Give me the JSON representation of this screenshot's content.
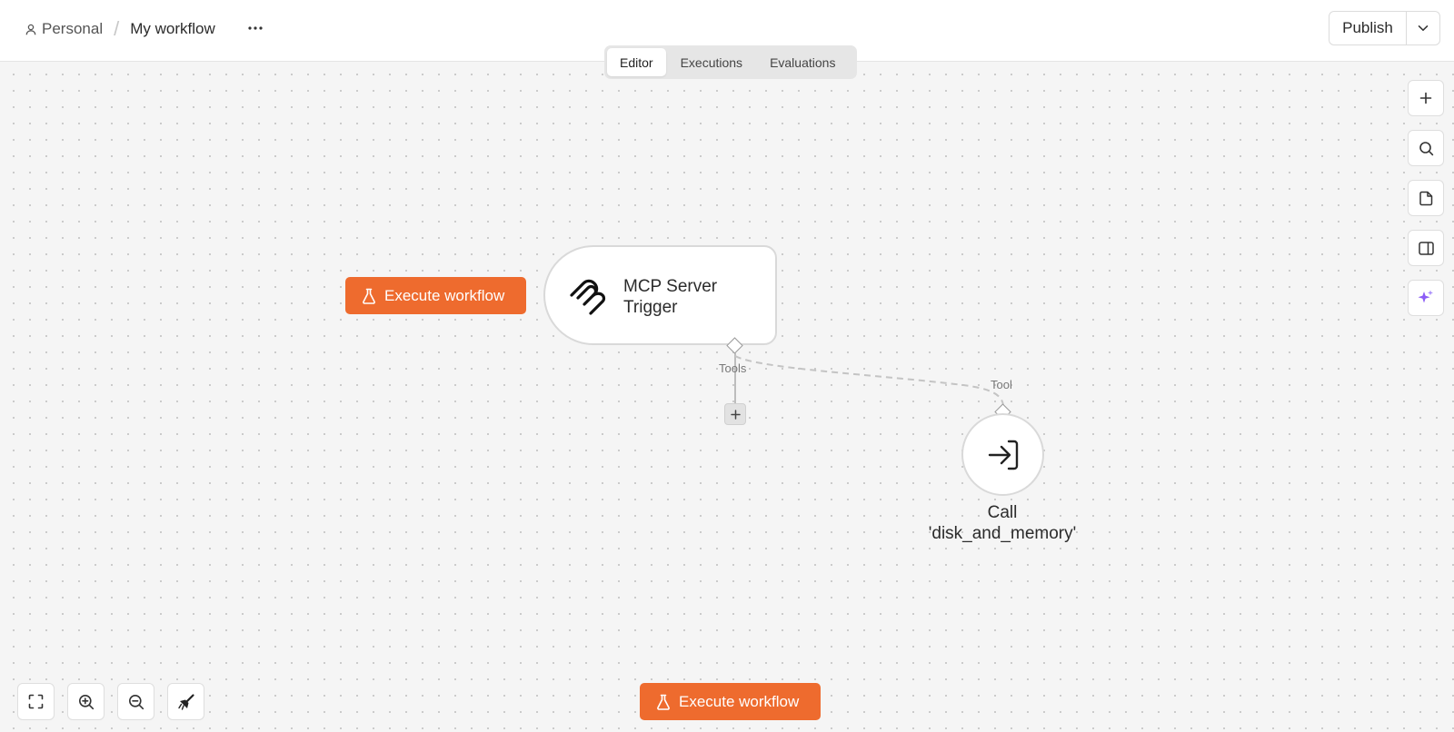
{
  "header": {
    "breadcrumb_project": "Personal",
    "breadcrumb_separator": "/",
    "workflow_name": "My workflow",
    "more_label": "···",
    "publish_label": "Publish"
  },
  "tabs": [
    {
      "label": "Editor",
      "active": true
    },
    {
      "label": "Executions",
      "active": false
    },
    {
      "label": "Evaluations",
      "active": false
    }
  ],
  "canvas": {
    "execute_button_label": "Execute workflow",
    "nodes": {
      "trigger": {
        "label": "MCP Server Trigger",
        "icon": "mcp-icon"
      },
      "call": {
        "label": "Call 'disk_and_memory'",
        "icon": "sign-in-icon"
      }
    },
    "edge_labels": {
      "tools": "Tools",
      "tool": "Tool"
    },
    "add_tool_label": "+"
  },
  "right_toolbar": [
    {
      "icon": "plus-icon"
    },
    {
      "icon": "search-icon"
    },
    {
      "icon": "sticky-note-icon"
    },
    {
      "icon": "panel-icon"
    },
    {
      "icon": "sparkle-icon"
    }
  ],
  "bottom_controls": [
    {
      "icon": "fit-view-icon"
    },
    {
      "icon": "zoom-in-icon"
    },
    {
      "icon": "zoom-out-icon"
    },
    {
      "icon": "tidy-up-icon"
    }
  ],
  "colors": {
    "accent": "#ee6b2e",
    "ai_accent": "#8b5cf6",
    "canvas_bg": "#f5f5f5"
  }
}
